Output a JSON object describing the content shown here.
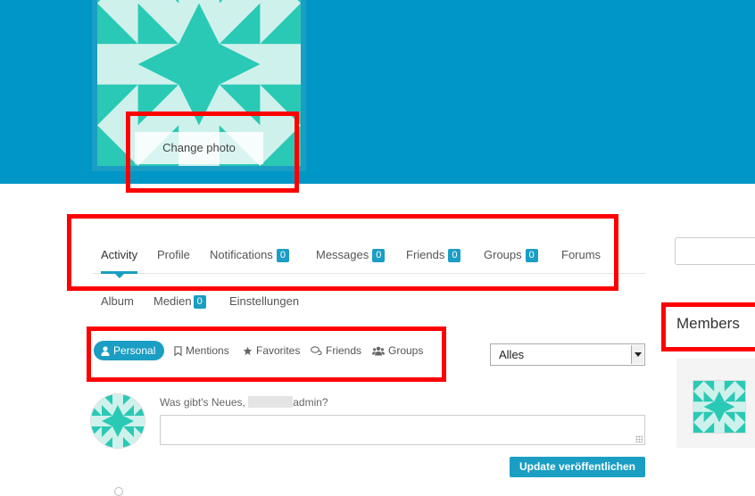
{
  "profile": {
    "change_photo_label": "Change photo"
  },
  "tabs": [
    {
      "label": "Activity",
      "badge": null,
      "active": true
    },
    {
      "label": "Profile",
      "badge": null
    },
    {
      "label": "Notifications",
      "badge": "0"
    },
    {
      "label": "Messages",
      "badge": "0"
    },
    {
      "label": "Friends",
      "badge": "0"
    },
    {
      "label": "Groups",
      "badge": "0"
    },
    {
      "label": "Forums",
      "badge": null
    }
  ],
  "subnav": [
    {
      "label": "Album",
      "badge": null
    },
    {
      "label": "Medien",
      "badge": "0"
    },
    {
      "label": "Einstellungen",
      "badge": null
    }
  ],
  "filters": [
    {
      "label": "Personal",
      "icon": "user-icon",
      "active": true
    },
    {
      "label": "Mentions",
      "icon": "bookmark-icon"
    },
    {
      "label": "Favorites",
      "icon": "star-icon"
    },
    {
      "label": "Friends",
      "icon": "chat-bubbles-icon"
    },
    {
      "label": "Groups",
      "icon": "users-icon"
    }
  ],
  "activity_filter": {
    "selected": "Alles"
  },
  "post_form": {
    "prompt_prefix": "Was gibt's Neues,",
    "prompt_suffix": "admin?",
    "submit_label": "Update veröffentlichen"
  },
  "sidebar": {
    "members_title": "Members"
  },
  "colors": {
    "cover": "#0097c7",
    "accent": "#1a9ec3",
    "avatar_teal": "#2ac9b5",
    "highlight": "#ff0000"
  }
}
